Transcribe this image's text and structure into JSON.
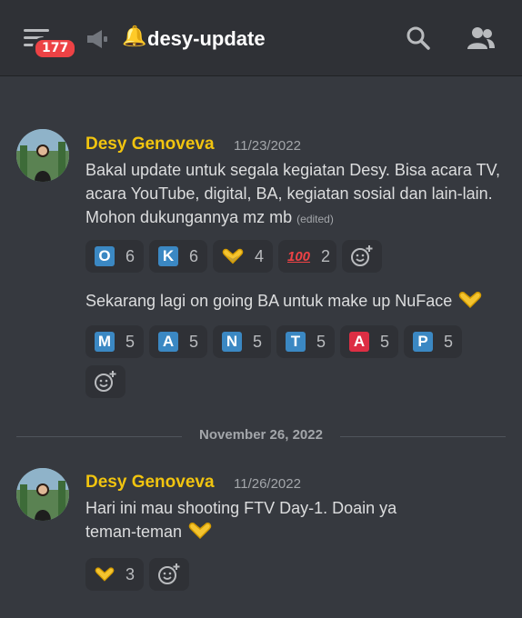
{
  "header": {
    "badge_count": "177",
    "bell_emoji": "🔔",
    "channel_name": "desy-update",
    "icons": [
      "menu-icon",
      "megaphone-icon",
      "search-icon",
      "members-icon"
    ]
  },
  "messages": [
    {
      "author": "Desy Genoveva",
      "timestamp": "11/23/2022",
      "author_color": "#f1c40f",
      "text": "Bakal update untuk segala kegiatan Desy. Bisa acara TV, acara YouTube, digital, BA, kegiatan sosial dan lain-lain. Mohon dukungannya mz mb",
      "edited": "(edited)",
      "reactions": [
        {
          "emoji": "O",
          "type": "letter",
          "count": "6"
        },
        {
          "emoji": "K",
          "type": "letter",
          "count": "6"
        },
        {
          "emoji": "🫶",
          "type": "hand-heart",
          "count": "4"
        },
        {
          "emoji": "100",
          "type": "hundred",
          "count": "2"
        }
      ]
    },
    {
      "text": "Sekarang lagi on going BA untuk make up NuFace",
      "reactions": [
        {
          "emoji": "M",
          "type": "letter",
          "count": "5"
        },
        {
          "emoji": "A",
          "type": "letter",
          "count": "5"
        },
        {
          "emoji": "N",
          "type": "letter",
          "count": "5"
        },
        {
          "emoji": "T",
          "type": "letter",
          "count": "5"
        },
        {
          "emoji": "A",
          "type": "letter-red",
          "count": "5"
        },
        {
          "emoji": "P",
          "type": "letter",
          "count": "5"
        }
      ]
    },
    {
      "author": "Desy Genoveva",
      "timestamp": "11/26/2022",
      "text_line1": "Hari ini mau shooting FTV Day-1. Doain ya",
      "text_line2": "teman-teman",
      "reactions": [
        {
          "emoji": "🫶",
          "type": "hand-heart",
          "count": "3"
        }
      ]
    }
  ],
  "date_divider": "November 26, 2022",
  "colors": {
    "background": "#36393f",
    "header": "#2f3136",
    "accent_author": "#f1c40f",
    "badge": "#ed4245"
  }
}
